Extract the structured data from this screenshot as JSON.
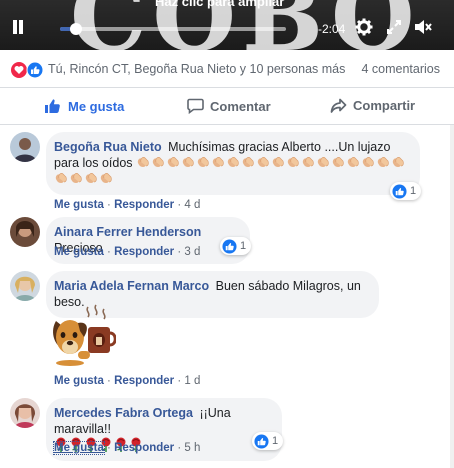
{
  "video": {
    "hint": "Haz clic para ampliar",
    "time_remaining": "-2:04",
    "progress": 0.07
  },
  "reactions": {
    "names": "Tú, Rincón CT, Begoña Rua Nieto y 10 personas más",
    "comments_count": "4 comentarios",
    "icons": [
      "love-icon",
      "like-icon"
    ]
  },
  "actions": {
    "like": "Me gusta",
    "comment": "Comentar",
    "share": "Compartir"
  },
  "comments": [
    {
      "author": "Begoña Rua Nieto",
      "text": "Muchísimas gracias Alberto ....Un lujazo para los oídos",
      "clap_count": 22,
      "like_label": "Me gusta",
      "reply_label": "Responder",
      "time": "4 d",
      "reaction_count": "1"
    },
    {
      "author": "Ainara Ferrer Henderson",
      "text": "Precioso",
      "like_label": "Me gusta",
      "reply_label": "Responder",
      "time": "3 d",
      "reaction_count": "1"
    },
    {
      "author": "Maria Adela Fernan Marco",
      "text": "Buen sábado Milagros, un beso.",
      "like_label": "Me gusta",
      "reply_label": "Responder",
      "time": "1 d"
    },
    {
      "author": "Mercedes Fabra Ortega",
      "text": "¡¡Una maravilla!!",
      "rose_count": 6,
      "like_label": "Me gusta",
      "reply_label": "Responder",
      "time": "5 h",
      "reaction_count": "1"
    }
  ],
  "colors": {
    "accent": "#2d6be0",
    "author": "#385898",
    "bubble": "#f2f3f5",
    "muted": "#606770"
  }
}
